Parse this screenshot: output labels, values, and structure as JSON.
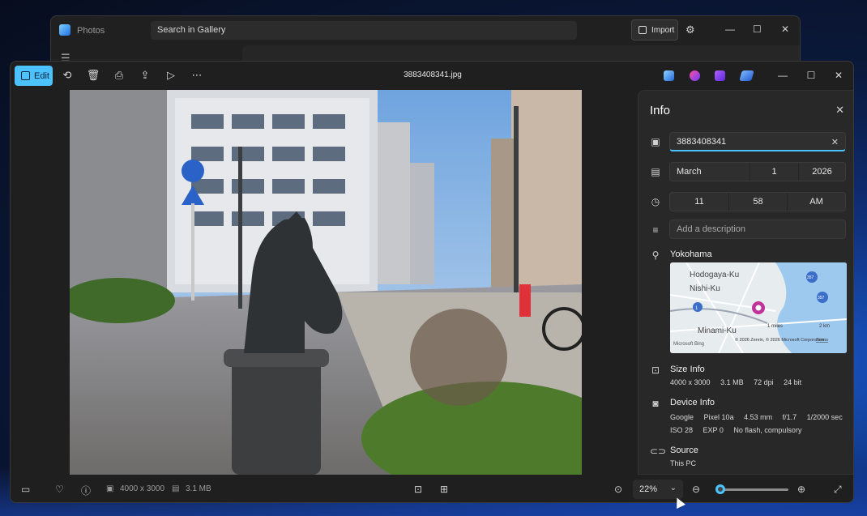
{
  "gallery": {
    "title": "Photos",
    "search_placeholder": "Search in Gallery",
    "import_label": "Import"
  },
  "viewer": {
    "edit_label": "Edit",
    "filename": "3883408341.jpg"
  },
  "info": {
    "title": "Info",
    "name_value": "3883408341",
    "date": {
      "month": "March",
      "day": "1",
      "year": "2026"
    },
    "time": {
      "hour": "11",
      "minute": "58",
      "period": "AM"
    },
    "description_placeholder": "Add a description",
    "location": "Yokohama",
    "map_labels": {
      "l1": "Hodogaya-Ku",
      "l2": "Nishi-Ku",
      "l3": "Minami-Ku",
      "road1": "1",
      "road2": "357",
      "road3": "357",
      "scale_miles": "1 miles",
      "scale_km": "2 km",
      "attribution": "© 2026 Zenrin, © 2026 Microsoft Corporation",
      "terms": "Terms",
      "provider": "Microsoft Bing"
    },
    "size": {
      "label": "Size Info",
      "dims": "4000 x 3000",
      "filesize": "3.1 MB",
      "dpi": "72 dpi",
      "bits": "24 bit"
    },
    "device": {
      "label": "Device Info",
      "make": "Google",
      "model": "Pixel 10a",
      "focal": "4.53 mm",
      "aperture": "f/1.7",
      "shutter": "1/2000 sec",
      "iso": "ISO 28",
      "exp": "EXP 0",
      "flash": "No flash, compulsory"
    },
    "source": {
      "label": "Source",
      "value": "This PC"
    }
  },
  "bottom": {
    "dims": "4000 x 3000",
    "filesize": "3.1 MB",
    "zoom": "22%",
    "zoom_level": 0.04
  }
}
